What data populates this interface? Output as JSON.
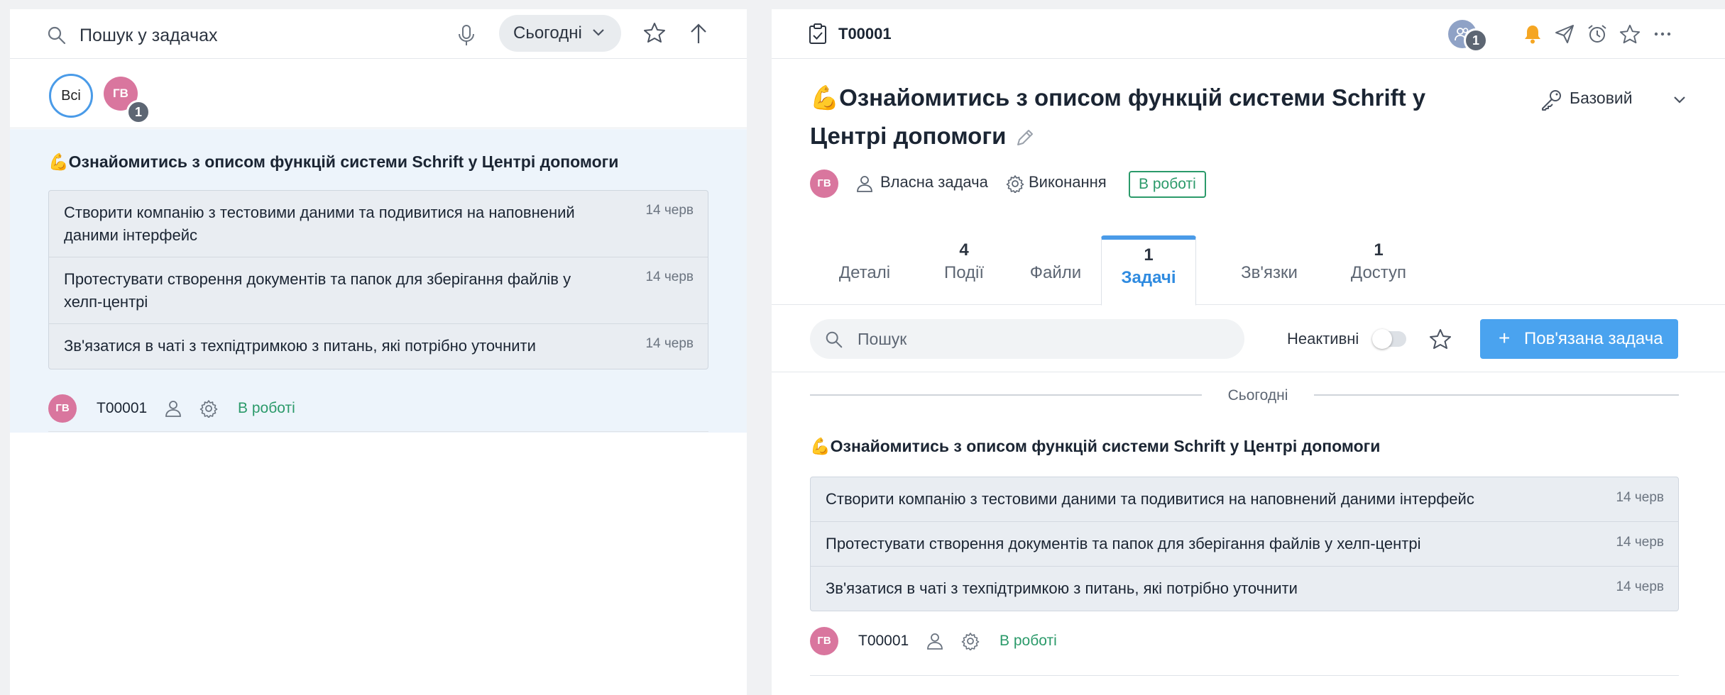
{
  "left_panel": {
    "search_placeholder": "Пошук у задачах",
    "period_dropdown": "Сьогодні",
    "filter_all": "Всі",
    "filter_user_initials": "ГВ",
    "filter_user_count": "1",
    "task": {
      "title": "💪Ознайомитись з описом функцій системи Schrift у Центрі допомоги",
      "subtasks": [
        {
          "text": "Створити компанію з тестовими даними та подивитися на наповнений даними інтерфейс",
          "date": "14 черв"
        },
        {
          "text": "Протестувати створення документів та папок для зберігання файлів у хелп-центрі",
          "date": "14 черв"
        },
        {
          "text": "Зв'язатися в чаті з техпідтримкою з питань, які потрібно уточнити",
          "date": "14 черв"
        }
      ],
      "avatar": "ГВ",
      "id": "T00001",
      "status": "В роботі"
    }
  },
  "right_panel": {
    "task_id": "T00001",
    "participants_count": "1",
    "title": "💪Ознайомитись з описом функцій системи Schrift у Центрі допомоги",
    "access_level": "Базовий",
    "avatar": "ГВ",
    "owner_type": "Власна задача",
    "stage": "Виконання",
    "status": "В роботі",
    "tabs": [
      {
        "count": "",
        "label": "Деталі"
      },
      {
        "count": "4",
        "label": "Події"
      },
      {
        "count": "",
        "label": "Файли"
      },
      {
        "count": "1",
        "label": "Задачі"
      },
      {
        "count": "",
        "label": "Зв'язки"
      },
      {
        "count": "1",
        "label": "Доступ"
      }
    ],
    "search_placeholder": "Пошук",
    "inactive_label": "Неактивні",
    "add_button": "Пов'язана задача",
    "group_label": "Сьогодні",
    "task": {
      "title": "💪Ознайомитись з описом функцій системи Schrift у Центрі допомоги",
      "subtasks": [
        {
          "text": "Створити компанію з тестовими даними та подивитися на наповнений даними інтерфейс",
          "date": "14 черв"
        },
        {
          "text": "Протестувати створення документів та папок для зберігання файлів у хелп-центрі",
          "date": "14 черв"
        },
        {
          "text": "Зв'язатися в чаті з техпідтримкою з питань, які потрібно уточнити",
          "date": "14 черв"
        }
      ],
      "avatar": "ГВ",
      "id": "T00001",
      "status": "В роботі"
    }
  },
  "colors": {
    "accent": "#4a9be8",
    "status_green": "#2b9a6a",
    "avatar_pink": "#d9769e",
    "bell_orange": "#f5a623"
  }
}
